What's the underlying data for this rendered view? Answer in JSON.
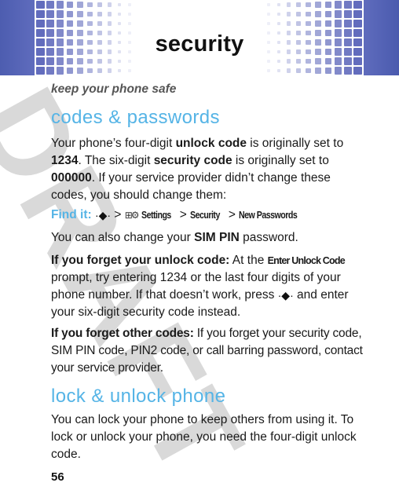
{
  "header": {
    "title": "security",
    "banner_color": "#4d5db0"
  },
  "subtitle": "keep your phone safe",
  "sections": [
    {
      "heading": "codes & passwords",
      "intro": {
        "t1": "Your phone’s four-digit ",
        "b1": "unlock code",
        "t2": " is originally set to ",
        "b2": "1234",
        "t3": ". The six-digit ",
        "b3": "security code",
        "t4": " is originally set to ",
        "b4": "000000",
        "t5": ". If your service provider didn’t change these codes, you should change them:"
      },
      "find_it": {
        "label": "Find it:",
        "nav_key_icon": "nav-key-icon",
        "sep": ">",
        "settings_icon": "settings-icon",
        "path": [
          "Settings",
          "Security",
          "New Passwords"
        ]
      },
      "sim_pin": {
        "t1": "You can also change your ",
        "b1": "SIM PIN",
        "t2": " password."
      },
      "forget_unlock": {
        "lead": "If you forget your unlock code:",
        "t1": " At the ",
        "prompt": "Enter Unlock Code",
        "t2": " prompt, try entering 1234 or the last four digits of your phone number. If that doesn’t work, press ",
        "t3": " and enter your six-digit security code instead."
      },
      "forget_other": {
        "lead": "If you forget other codes:",
        "t1": " If you forget your security code, SIM PIN code, PIN2 code, or call barring password, contact your service provider."
      }
    },
    {
      "heading": "lock & unlock phone",
      "body": "You can lock your phone to keep others from using it. To lock or unlock your phone, you need the four-digit unlock code."
    }
  ],
  "watermark": "DRAFT",
  "page_number": "56",
  "colors": {
    "heading_blue": "#55b4e6",
    "watermark_gray": "#d9d9d9"
  }
}
